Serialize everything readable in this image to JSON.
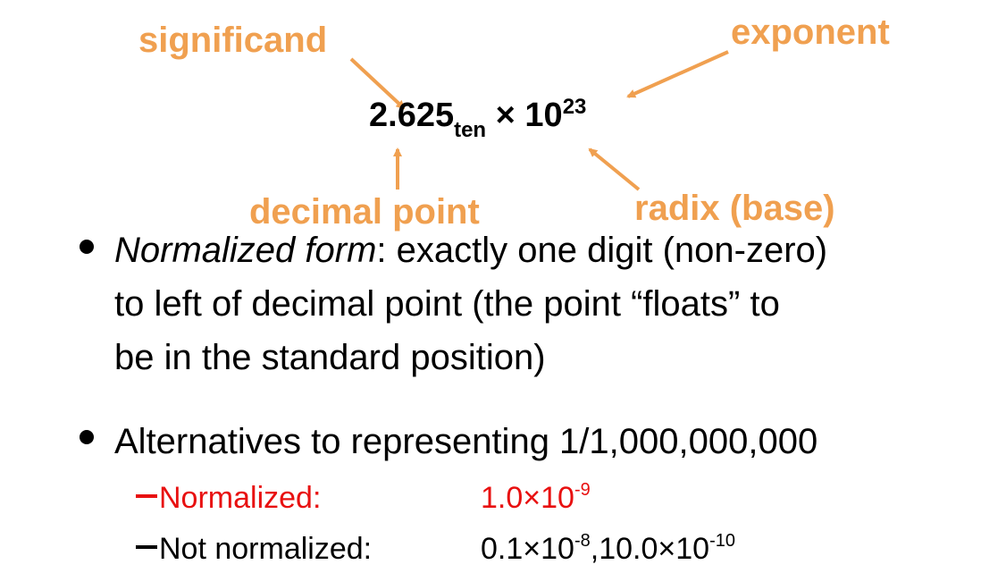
{
  "annotations": {
    "significand": "significand",
    "exponent": "exponent",
    "decimal_point": "decimal point",
    "radix": "radix (base)"
  },
  "equation": {
    "mantissa": "2.625",
    "base_subscript": "ten",
    "times_ten": "× 10",
    "exponent": "23"
  },
  "bullets": [
    {
      "emphasis": "Normalized form",
      "lines": [
        ":  exactly one digit (non-zero)",
        "to left of decimal point (the point “floats” to",
        "be in the standard position)"
      ]
    },
    {
      "lines": [
        "Alternatives to representing 1/1,000,000,000"
      ]
    }
  ],
  "alternatives": [
    {
      "label": "Normalized:",
      "base": "1.0×10",
      "exp": "-9"
    },
    {
      "label": "Not normalized:",
      "base1": "0.1×10",
      "exp1": "-8",
      "sep": ",",
      "base2": "10.0×10",
      "exp2": "-10"
    }
  ],
  "colors": {
    "annotation": "#f0a050",
    "highlight_red": "#e81010",
    "text": "#000000"
  }
}
